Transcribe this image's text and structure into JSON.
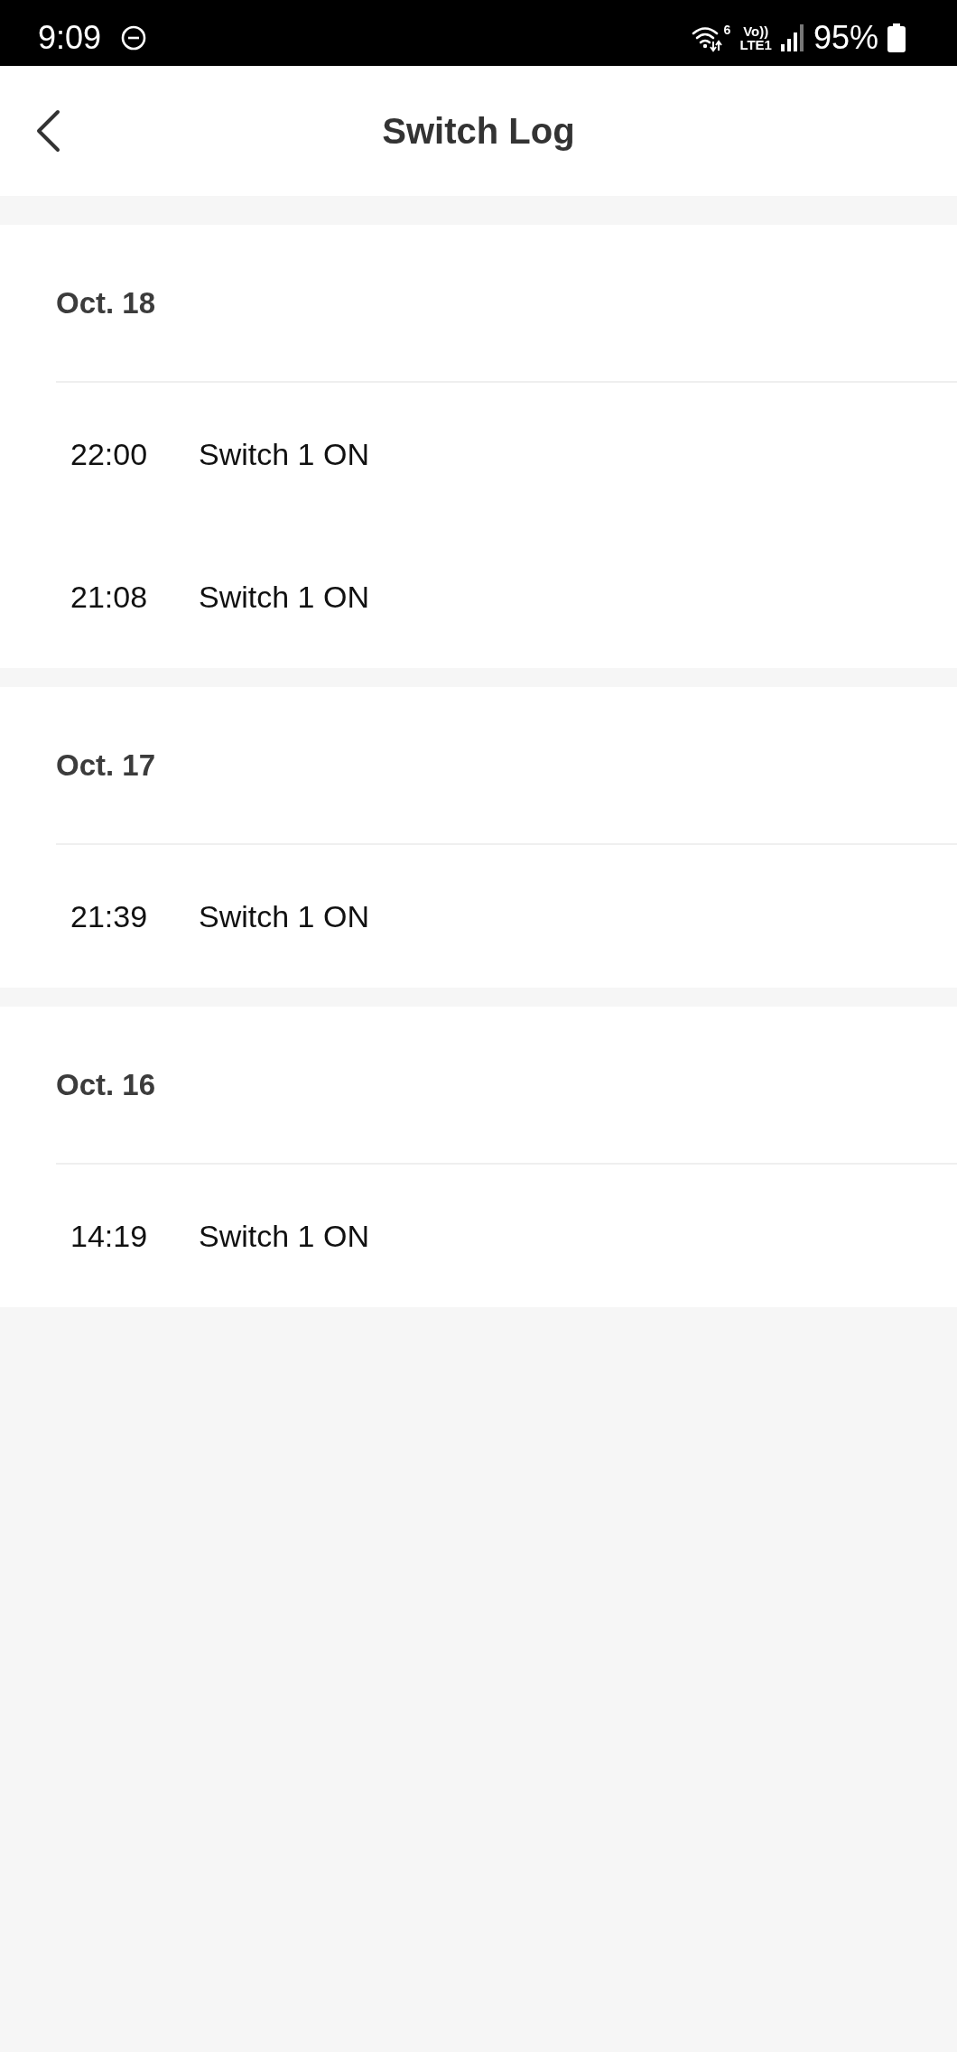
{
  "status_bar": {
    "time": "9:09",
    "wifi_badge": "6",
    "network_top": "Vo))",
    "network_bottom": "LTE1",
    "battery": "95%"
  },
  "header": {
    "title": "Switch Log"
  },
  "days": [
    {
      "date": "Oct. 18",
      "entries": [
        {
          "time": "22:00",
          "event": "Switch 1 ON"
        },
        {
          "time": "21:08",
          "event": "Switch 1 ON"
        }
      ]
    },
    {
      "date": "Oct. 17",
      "entries": [
        {
          "time": "21:39",
          "event": "Switch 1 ON"
        }
      ]
    },
    {
      "date": "Oct. 16",
      "entries": [
        {
          "time": "14:19",
          "event": "Switch 1 ON"
        }
      ]
    }
  ]
}
